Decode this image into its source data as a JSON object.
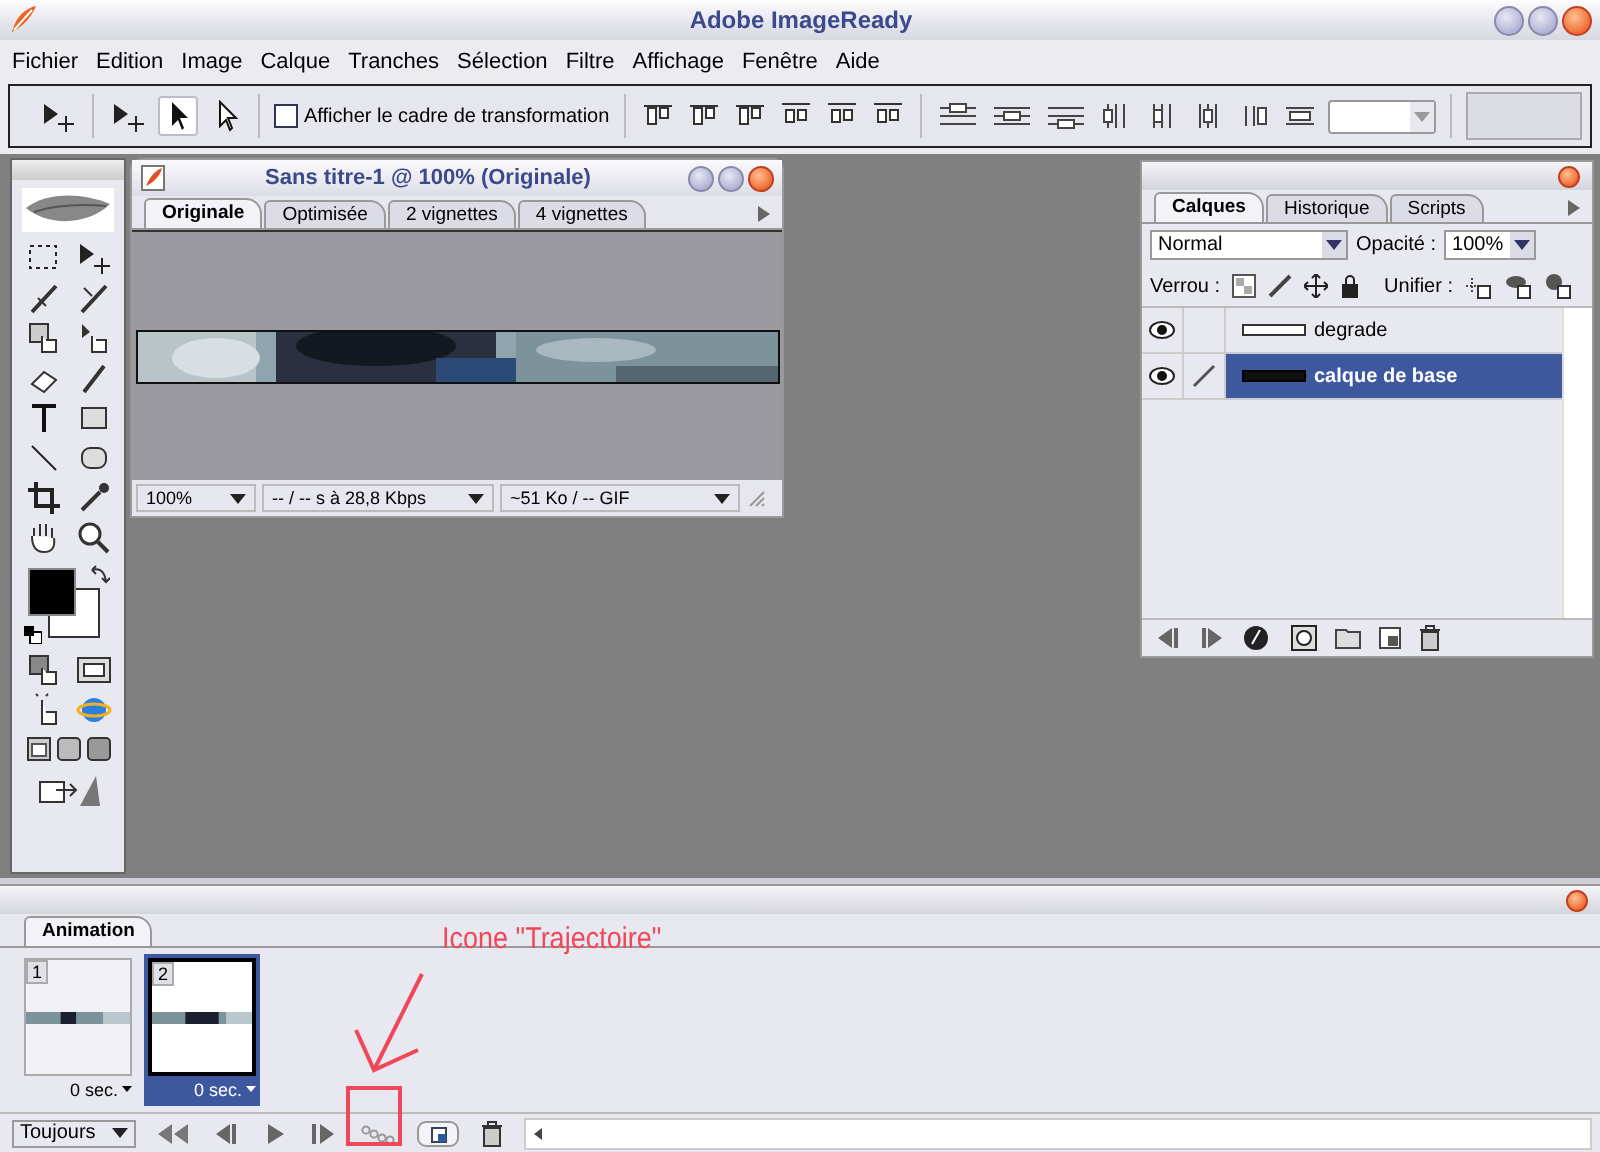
{
  "window": {
    "title": "Adobe ImageReady"
  },
  "menu": [
    "Fichier",
    "Edition",
    "Image",
    "Calque",
    "Tranches",
    "Sélection",
    "Filtre",
    "Affichage",
    "Fenêtre",
    "Aide"
  ],
  "options_bar": {
    "transform_checkbox": {
      "label": "Afficher le cadre de transformation",
      "checked": false
    }
  },
  "document": {
    "title": "Sans titre-1 @ 100% (Originale)",
    "tabs": [
      {
        "label": "Originale",
        "selected": true
      },
      {
        "label": "Optimisée",
        "selected": false
      },
      {
        "label": "2 vignettes",
        "selected": false
      },
      {
        "label": "4 vignettes",
        "selected": false
      }
    ],
    "status": {
      "zoom": "100%",
      "download": "-- / -- s à 28,8 Kbps",
      "size": "~51 Ko / -- GIF"
    }
  },
  "layers_palette": {
    "tabs": [
      {
        "label": "Calques",
        "selected": true
      },
      {
        "label": "Historique",
        "selected": false
      },
      {
        "label": "Scripts",
        "selected": false
      }
    ],
    "blend_mode": "Normal",
    "opacity_label": "Opacité :",
    "opacity": "100%",
    "lock_label": "Verrou :",
    "unify_label": "Unifier :",
    "layers": [
      {
        "name": "degrade",
        "selected": false,
        "visible": true,
        "brush": false
      },
      {
        "name": "calque de base",
        "selected": true,
        "visible": true,
        "brush": true
      }
    ]
  },
  "animation": {
    "tab": "Animation",
    "frames": [
      {
        "number": "1",
        "delay": "0 sec.",
        "selected": false
      },
      {
        "number": "2",
        "delay": "0 sec.",
        "selected": true
      }
    ],
    "loop": "Toujours"
  },
  "annotation": {
    "text": "Icone \"Trajectoire\""
  }
}
